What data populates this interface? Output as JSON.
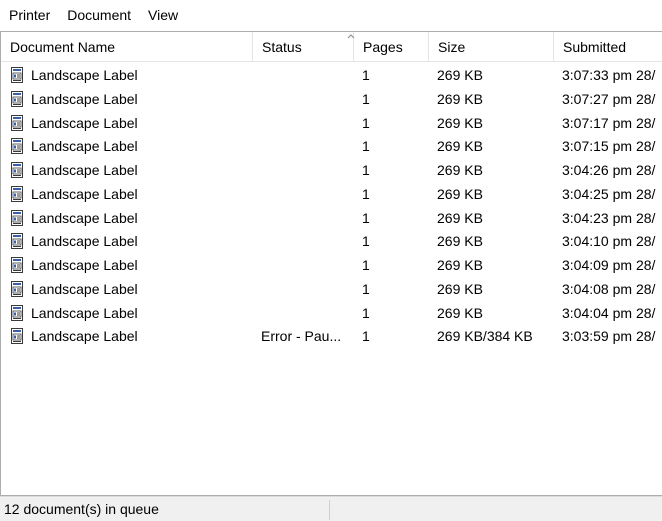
{
  "menu": {
    "items": [
      "Printer",
      "Document",
      "View"
    ]
  },
  "columns": [
    "Document Name",
    "Status",
    "Pages",
    "Size",
    "Submitted"
  ],
  "rows": [
    {
      "name": "Landscape Label",
      "status": "",
      "pages": "1",
      "size": "269 KB",
      "submitted": "3:07:33 pm  28/"
    },
    {
      "name": "Landscape Label",
      "status": "",
      "pages": "1",
      "size": "269 KB",
      "submitted": "3:07:27 pm  28/"
    },
    {
      "name": "Landscape Label",
      "status": "",
      "pages": "1",
      "size": "269 KB",
      "submitted": "3:07:17 pm  28/"
    },
    {
      "name": "Landscape Label",
      "status": "",
      "pages": "1",
      "size": "269 KB",
      "submitted": "3:07:15 pm  28/"
    },
    {
      "name": "Landscape Label",
      "status": "",
      "pages": "1",
      "size": "269 KB",
      "submitted": "3:04:26 pm  28/"
    },
    {
      "name": "Landscape Label",
      "status": "",
      "pages": "1",
      "size": "269 KB",
      "submitted": "3:04:25 pm  28/"
    },
    {
      "name": "Landscape Label",
      "status": "",
      "pages": "1",
      "size": "269 KB",
      "submitted": "3:04:23 pm  28/"
    },
    {
      "name": "Landscape Label",
      "status": "",
      "pages": "1",
      "size": "269 KB",
      "submitted": "3:04:10 pm  28/"
    },
    {
      "name": "Landscape Label",
      "status": "",
      "pages": "1",
      "size": "269 KB",
      "submitted": "3:04:09 pm  28/"
    },
    {
      "name": "Landscape Label",
      "status": "",
      "pages": "1",
      "size": "269 KB",
      "submitted": "3:04:08 pm  28/"
    },
    {
      "name": "Landscape Label",
      "status": "",
      "pages": "1",
      "size": "269 KB",
      "submitted": "3:04:04 pm  28/"
    },
    {
      "name": "Landscape Label",
      "status": "Error - Pau...",
      "pages": "1",
      "size": "269 KB/384 KB",
      "submitted": "3:03:59 pm  28/"
    }
  ],
  "row_icon": "document-icon",
  "scrollbar": {
    "left_icon": "scroll-left-icon",
    "right_icon": "scroll-right-icon"
  },
  "status": {
    "text": "12 document(s) in queue"
  },
  "colors": {
    "border": "#adadad",
    "chrome": "#f0f0f0",
    "thumb": "#cdcdcd"
  }
}
